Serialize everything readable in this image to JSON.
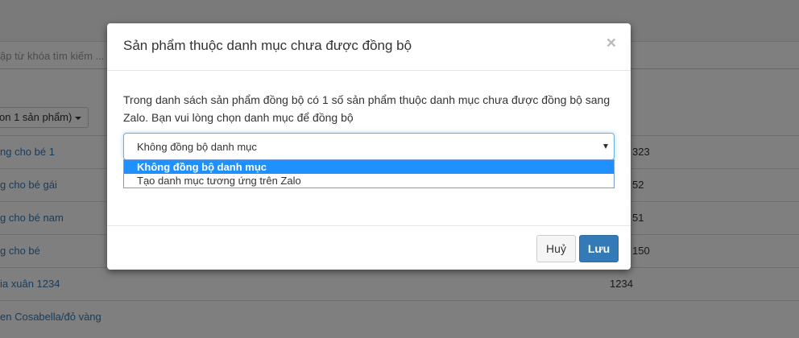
{
  "background": {
    "search_placeholder": "ập từ khóa tìm kiếm ...",
    "filter_label": "on 1 sản phẩm)",
    "rows": [
      {
        "name": "ng cho bé 1",
        "value": "323"
      },
      {
        "name": "g cho bé gái",
        "value": "52"
      },
      {
        "name": "g cho bé nam",
        "value": "51"
      },
      {
        "name": "g cho bé",
        "value": "150"
      },
      {
        "name": "ia xuân 1234",
        "value": "1234"
      },
      {
        "name": "en Cosabella/đỏ vàng",
        "value": ""
      }
    ]
  },
  "modal": {
    "title": "Sản phẩm thuộc danh mục chưa được đồng bộ",
    "close_symbol": "×",
    "description": "Trong danh sách sản phẩm đồng bộ có 1 số sản phẩm thuộc danh mục chưa được đồng bộ sang Zalo. Bạn vui lòng chọn danh mục để đồng bộ",
    "select": {
      "value": "Không đồng bộ danh mục",
      "options": [
        "Không đồng bộ danh mục",
        "Tạo danh mục tương ứng trên Zalo"
      ]
    },
    "buttons": {
      "cancel": "Huỷ",
      "save": "Lưu"
    }
  }
}
